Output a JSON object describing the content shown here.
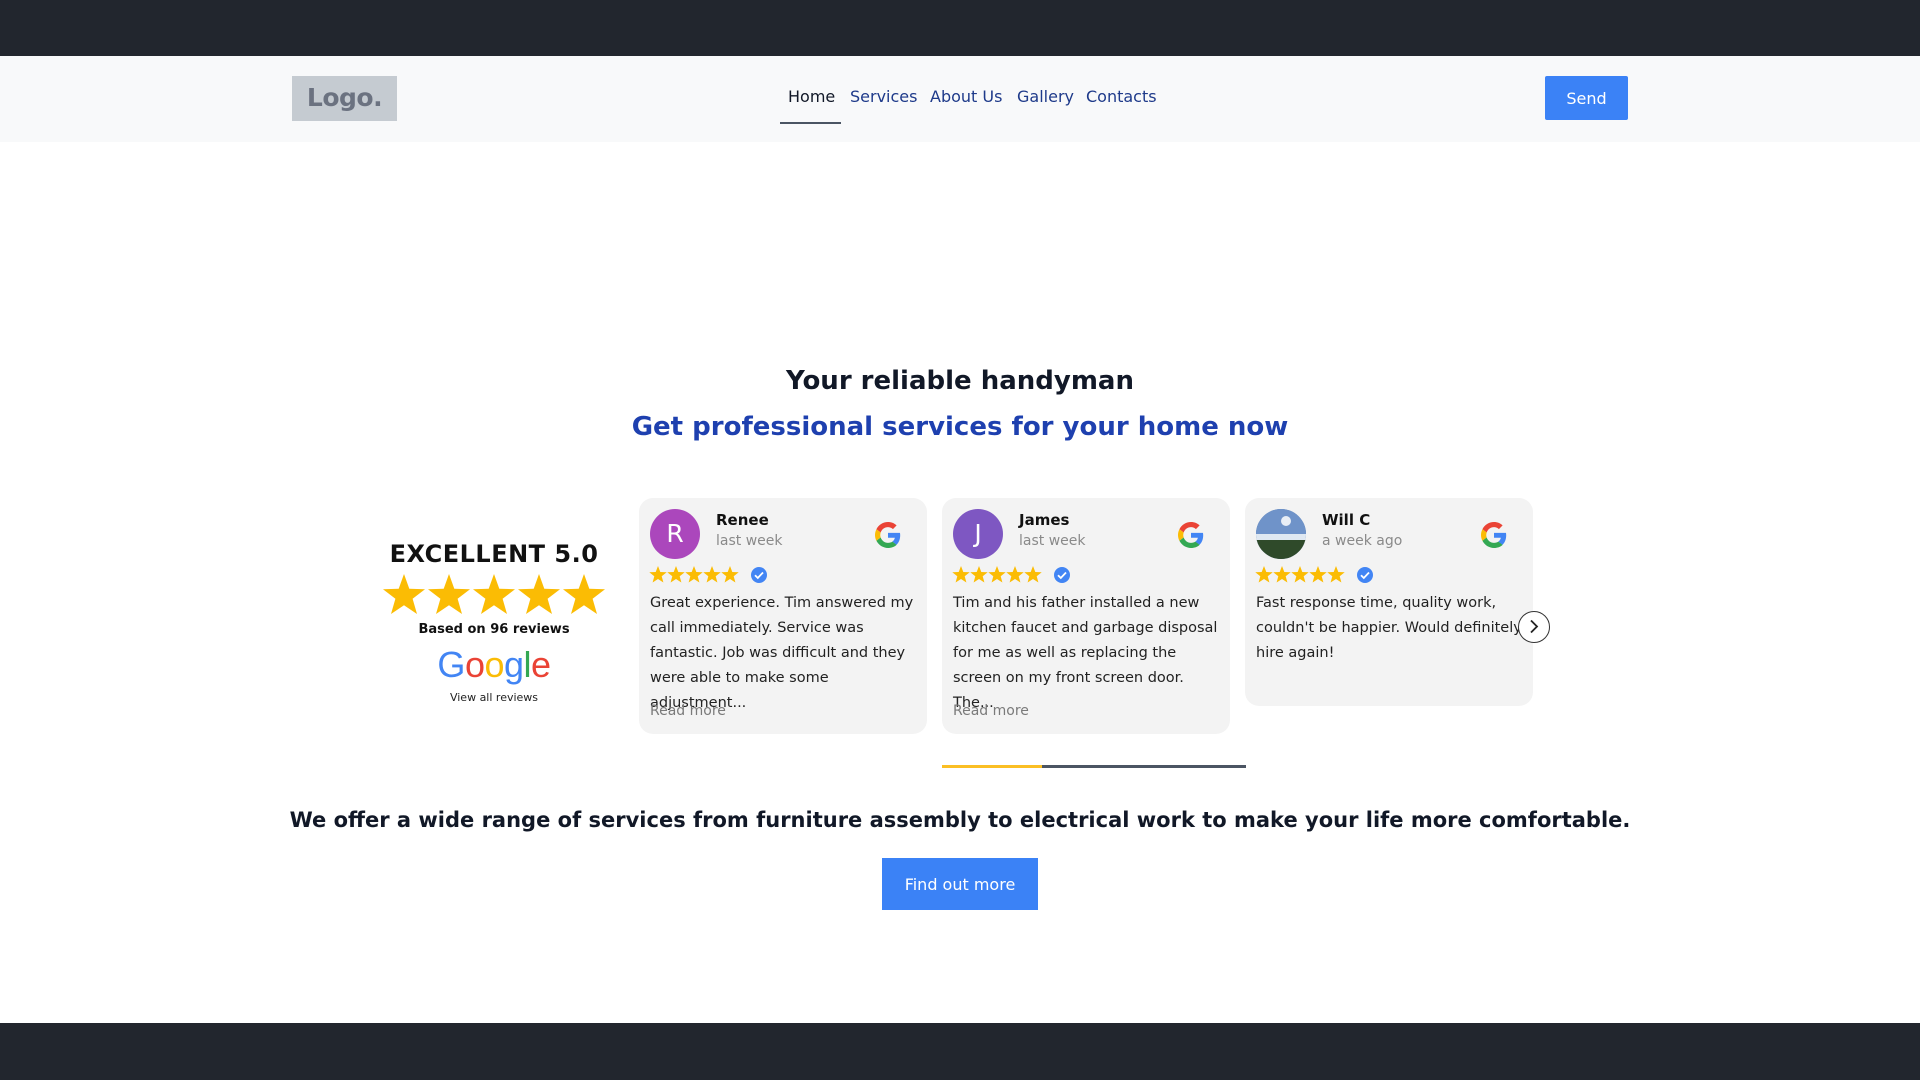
{
  "header": {
    "logo_text": "Logo.",
    "nav": [
      {
        "label": "Home",
        "active": true
      },
      {
        "label": "Services",
        "active": false
      },
      {
        "label": "About Us",
        "active": false
      },
      {
        "label": "Gallery",
        "active": false
      },
      {
        "label": "Contacts",
        "active": false
      }
    ],
    "send_label": "Send"
  },
  "hero": {
    "title": "Your reliable handyman",
    "subtitle": "Get professional services for your home now"
  },
  "reviews_summary": {
    "title": "EXCELLENT 5.0",
    "rating": 5,
    "based_on": "Based on 96 reviews",
    "brand": "Google",
    "view_all": "View all reviews"
  },
  "reviews": [
    {
      "initial": "R",
      "name": "Renee",
      "time": "last week",
      "rating": 5,
      "verified": true,
      "avatar_color": "#ab47bc",
      "text": "Great experience. Tim answered my call immediately. Service was fantastic. Job was difficult and they were able to make some adjustment...",
      "read_more": "Read more"
    },
    {
      "initial": "J",
      "name": "James",
      "time": "last week",
      "rating": 5,
      "verified": true,
      "avatar_color": "#7e57c2",
      "text": "Tim and his father installed a new kitchen faucet and garbage disposal for me as well as replacing the screen on my front screen door. The...",
      "read_more": "Read more"
    },
    {
      "initial": "",
      "name": "Will C",
      "time": "a week ago",
      "rating": 5,
      "verified": true,
      "avatar_color": "#4a6fa5",
      "text": "Fast response time, quality work, couldn't be happier. Would definitely hire again!",
      "read_more": ""
    }
  ],
  "carousel": {
    "progress": 0.33
  },
  "services": {
    "tagline": "We offer a wide range of services from furniture assembly to electrical work to make your life more comfortable.",
    "cta_label": "Find out more"
  },
  "colors": {
    "dark_bar": "#22262e",
    "accent_blue": "#3b82f6",
    "heading_blue": "#1e40af",
    "star_gold": "#fbbc04",
    "progress_gold": "#fbbf24"
  }
}
